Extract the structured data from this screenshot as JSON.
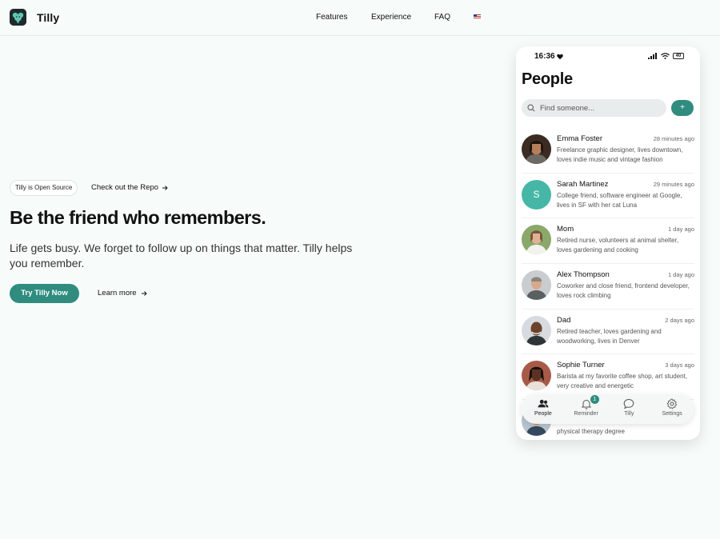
{
  "nav": {
    "brand": "Tilly",
    "links": [
      "Features",
      "Experience",
      "FAQ"
    ],
    "flag_icon": "us-flag-icon"
  },
  "hero": {
    "badge": "Tilly is Open Source",
    "repo_link": "Check out the Repo",
    "title": "Be the friend who remembers.",
    "subtitle": "Life gets busy. We forget to follow up on things that matter. Tilly helps you remember.",
    "cta_primary": "Try Tilly Now",
    "cta_secondary": "Learn more"
  },
  "phone": {
    "status_time": "16:36",
    "battery": "40",
    "title": "People",
    "search_placeholder": "Find someone...",
    "add_label": "+",
    "people": [
      {
        "name": "Emma Foster",
        "time": "28 minutes ago",
        "desc": "Freelance graphic designer, lives downtown, loves indie music and vintage fashion"
      },
      {
        "name": "Sarah Martinez",
        "time": "29 minutes ago",
        "desc": "College friend, software engineer at Google, lives in SF with her cat Luna",
        "initial": "S"
      },
      {
        "name": "Mom",
        "time": "1 day ago",
        "desc": "Retired nurse, volunteers at animal shelter, loves gardening and cooking"
      },
      {
        "name": "Alex Thompson",
        "time": "1 day ago",
        "desc": "Coworker and close friend, frontend developer, loves rock climbing"
      },
      {
        "name": "Dad",
        "time": "2 days ago",
        "desc": "Retired teacher, loves gardening and woodworking, lives in Denver"
      },
      {
        "name": "Sophie Turner",
        "time": "3 days ago",
        "desc": "Barista at my favorite coffee shop, art student, very creative and energetic"
      }
    ],
    "partial_row_desc": "physical therapy degree",
    "tabs": [
      {
        "label": "People",
        "icon": "people-icon"
      },
      {
        "label": "Reminder",
        "icon": "bell-icon",
        "badge": "1"
      },
      {
        "label": "Tilly",
        "icon": "chat-icon"
      },
      {
        "label": "Settings",
        "icon": "gear-icon"
      }
    ]
  },
  "colors": {
    "accent": "#2f8c7e",
    "background": "#f7fcfb",
    "avatar_letter_bg": "#46b7a6"
  }
}
